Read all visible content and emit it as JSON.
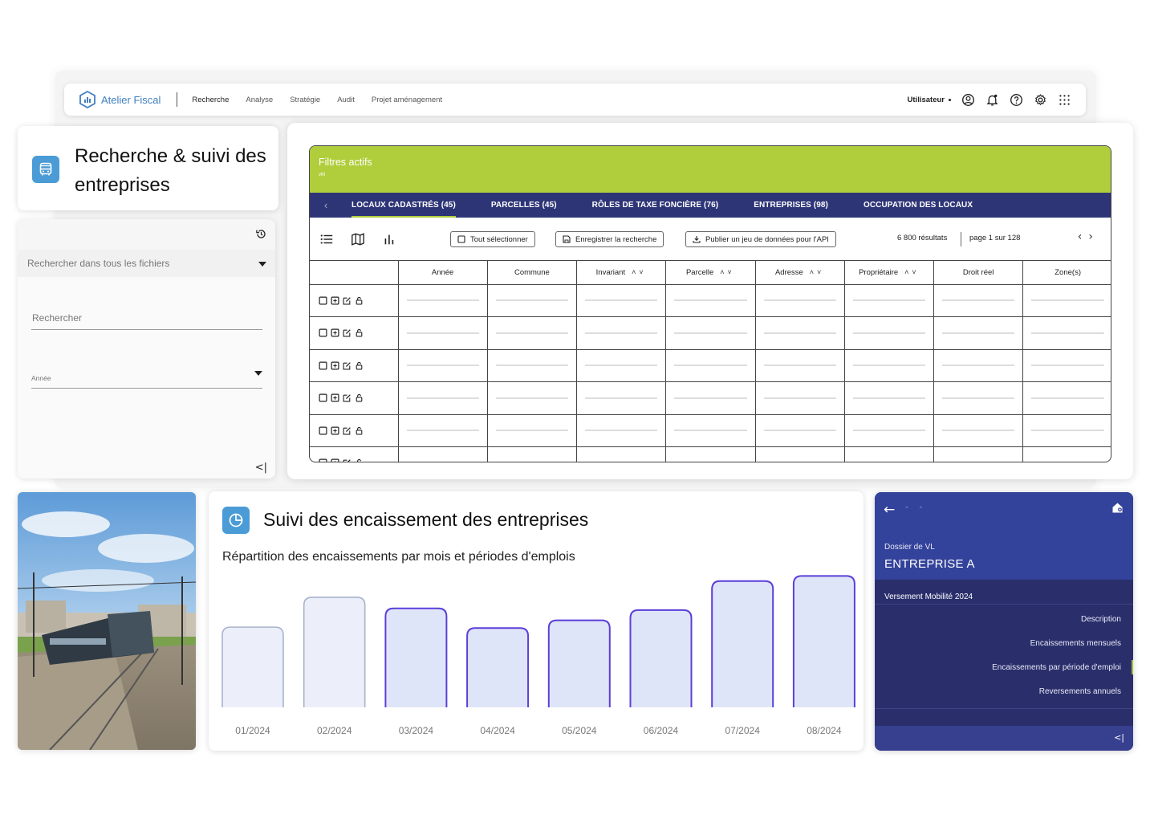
{
  "header": {
    "brand": "Atelier Fiscal",
    "nav": [
      "Recherche",
      "Analyse",
      "Stratégie",
      "Audit",
      "Projet aménagement"
    ],
    "user": "Utilisateur",
    "icons": [
      "account-icon",
      "bell-icon",
      "help-icon",
      "gear-icon",
      "apps-grid-icon"
    ]
  },
  "title_card": {
    "title": "Recherche & suivi des entreprises",
    "icon": "bus-icon"
  },
  "search_panel": {
    "search_all_placeholder": "Rechercher dans tous les fichiers",
    "search_label": "Rechercher",
    "year_label": "Année"
  },
  "table": {
    "filters_title": "Filtres actifs",
    "filters_sub": "vM",
    "tabs": [
      "LOCAUX CADASTRÉS (45)",
      "PARCELLES (45)",
      "RÔLES DE TAXE FONCIÈRE (76)",
      "ENTREPRISES (98)",
      "OCCUPATION DES LOCAUX"
    ],
    "toolbar": {
      "select_all": "Tout sélectionner",
      "save_search": "Enregistrer la recherche",
      "publish": "Publier un jeu de données pour l'API",
      "results": "6 800 résultats",
      "page": "page 1 sur 128"
    },
    "columns": [
      "Année",
      "Commune",
      "Invariant",
      "Parcelle",
      "Adresse",
      "Propriétaire",
      "Droit réel",
      "Zone(s)"
    ],
    "sortable_columns": [
      "Invariant",
      "Parcelle",
      "Adresse",
      "Propriétaire"
    ]
  },
  "chart_card": {
    "title": "Suivi des encaissement des entreprises",
    "subtitle": "Répartition des encaissements par mois et périodes d'emplois",
    "icon": "pie-chart-icon"
  },
  "chart_data": {
    "type": "bar",
    "categories": [
      "01/2024",
      "02/2024",
      "03/2024",
      "04/2024",
      "05/2024",
      "06/2024",
      "07/2024",
      "08/2024"
    ],
    "values": [
      94,
      129,
      116,
      93,
      102,
      114,
      148,
      154
    ],
    "highlighted": [
      false,
      false,
      true,
      true,
      true,
      true,
      true,
      true
    ],
    "colors": {
      "fill": "#dfe5f8",
      "fill_light": "#eceff9",
      "stroke": "#5b3fd9",
      "stroke_light": "#a7b4cb"
    },
    "ylim": [
      0,
      160
    ],
    "grid": false
  },
  "dossier": {
    "label": "Dossier de VL",
    "name": "ENTREPRISE A",
    "section": "Versement Mobilité 2024",
    "items": [
      "Description",
      "Encaissements mensuels",
      "Encaissements par période d'emploi",
      "Reversements annuels"
    ]
  }
}
